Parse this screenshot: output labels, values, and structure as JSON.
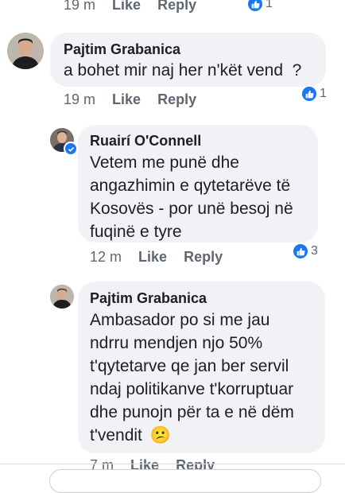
{
  "top_meta": {
    "time": "19 m",
    "like": "Like",
    "reply": "Reply",
    "reaction_count": "1"
  },
  "comment1": {
    "author": "Pajtim Grabanica",
    "text": "a bohet mir naj her n'kët vend  ?",
    "time": "19 m",
    "like": "Like",
    "reply": "Reply",
    "reaction_count": "1"
  },
  "comment2": {
    "author": "Ruairí O'Connell",
    "text_lines": [
      "Vetem me punë dhe",
      "angazhimin e qytetarëve të",
      "Kosovës - por unë besoj në",
      "fuqinë e tyre"
    ],
    "time": "12 m",
    "like": "Like",
    "reply": "Reply",
    "reaction_count": "3"
  },
  "comment3": {
    "author": "Pajtim Grabanica",
    "text_lines": [
      "Ambasador po si me jau",
      "ndrru mendjen njo 50%",
      "t'qytetarve qe jan ber servil",
      "ndaj politikanve t'korruptuar",
      "dhe punojn për ta e në dëm",
      "t'vendit"
    ],
    "emoji": "😕",
    "time": "7 m",
    "like": "Like",
    "reply": "Reply"
  },
  "colors": {
    "accent": "#1877f2",
    "bubble": "#f0f2f5",
    "meta": "#606770"
  }
}
